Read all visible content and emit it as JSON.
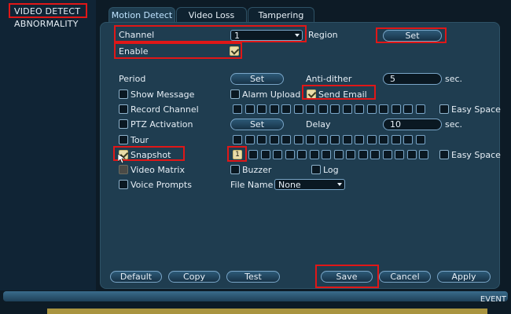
{
  "left_menu": {
    "items": [
      "VIDEO DETECT",
      "ABNORMALITY"
    ]
  },
  "tabs": [
    "Motion Detect",
    "Video Loss",
    "Tampering"
  ],
  "form": {
    "channel_label": "Channel",
    "channel_value": "1",
    "region_label": "Region",
    "region_button": "Set",
    "enable_label": "Enable",
    "period_label": "Period",
    "period_button": "Set",
    "anti_dither_label": "Anti-dither",
    "anti_dither_value": "5",
    "anti_dither_unit": "sec.",
    "show_message_label": "Show Message",
    "alarm_upload_label": "Alarm Upload",
    "send_email_label": "Send Email",
    "record_channel_label": "Record Channel",
    "easy_space_label": "Easy Space",
    "ptz_activation_label": "PTZ Activation",
    "ptz_button": "Set",
    "delay_label": "Delay",
    "delay_value": "10",
    "delay_unit": "sec.",
    "tour_label": "Tour",
    "snapshot_label": "Snapshot",
    "snapshot_channel": "1",
    "snapshot_easy_space_label": "Easy Space",
    "video_matrix_label": "Video Matrix",
    "buzzer_label": "Buzzer",
    "log_label": "Log",
    "voice_prompts_label": "Voice Prompts",
    "file_name_label": "File Name",
    "file_name_value": "None"
  },
  "footer": {
    "default": "Default",
    "copy": "Copy",
    "test": "Test",
    "save": "Save",
    "cancel": "Cancel",
    "apply": "Apply"
  },
  "status_bar": {
    "event": "EVENT"
  },
  "colors": {
    "panel": "#1f3d50",
    "highlight": "#e01717",
    "checked": "#e8dca8"
  }
}
